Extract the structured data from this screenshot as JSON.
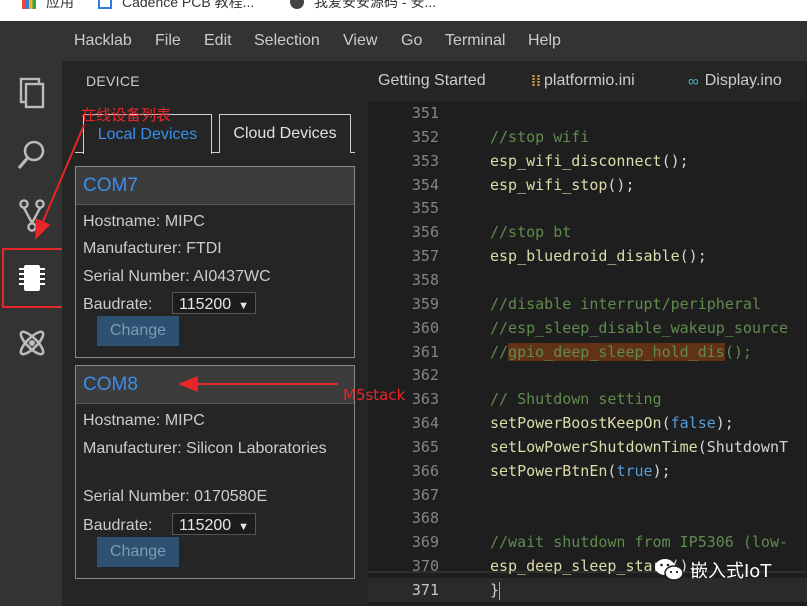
{
  "browser_bookmarks": [
    {
      "label": "应用"
    },
    {
      "label": "Cadence PCB 教程..."
    },
    {
      "label": "我爱安安源码 - 安..."
    }
  ],
  "menubar": {
    "items": [
      "Hacklab",
      "File",
      "Edit",
      "Selection",
      "View",
      "Go",
      "Terminal",
      "Help"
    ]
  },
  "activitybar": {
    "icons": [
      "explorer-icon",
      "search-icon",
      "source-control-icon",
      "device-chip-icon",
      "atom-icon"
    ]
  },
  "sidebar": {
    "title": "DEVICE",
    "tabs": [
      {
        "label": "Local Devices",
        "active": true
      },
      {
        "label": "Cloud Devices",
        "active": false
      }
    ],
    "devices": [
      {
        "port": "COM7",
        "hostname": "Hostname: MIPC",
        "manufacturer": "Manufacturer: FTDI",
        "serial": "Serial Number: AI0437WC",
        "baudrate_label": "Baudrate:",
        "baudrate_value": "115200",
        "change_label": "Change"
      },
      {
        "port": "COM8",
        "hostname": "Hostname: MIPC",
        "manufacturer": "Manufacturer: Silicon Laboratories",
        "serial": "Serial Number: 0170580E",
        "baudrate_label": "Baudrate:",
        "baudrate_value": "115200",
        "change_label": "Change"
      }
    ]
  },
  "editor": {
    "tabs": [
      {
        "label": "Getting Started",
        "icon": null
      },
      {
        "label": "platformio.ini",
        "icon": "ini-file-icon"
      },
      {
        "label": "Display.ino",
        "icon": "ino-file-icon"
      }
    ],
    "current_line": "371",
    "lines": [
      {
        "n": "351",
        "tokens": []
      },
      {
        "n": "352",
        "tokens": [
          {
            "t": "//stop wifi",
            "c": "comment"
          }
        ]
      },
      {
        "n": "353",
        "tokens": [
          {
            "t": "esp_wifi_disconnect",
            "c": "fn"
          },
          {
            "t": "();",
            "c": "plain"
          }
        ]
      },
      {
        "n": "354",
        "tokens": [
          {
            "t": "esp_wifi_stop",
            "c": "fn"
          },
          {
            "t": "();",
            "c": "plain"
          }
        ]
      },
      {
        "n": "355",
        "tokens": []
      },
      {
        "n": "356",
        "tokens": [
          {
            "t": "//stop bt",
            "c": "comment"
          }
        ]
      },
      {
        "n": "357",
        "tokens": [
          {
            "t": "esp_bluedroid_disable",
            "c": "fn"
          },
          {
            "t": "();",
            "c": "plain"
          }
        ]
      },
      {
        "n": "358",
        "tokens": []
      },
      {
        "n": "359",
        "tokens": [
          {
            "t": "//disable interrupt/peripheral",
            "c": "comment"
          }
        ]
      },
      {
        "n": "360",
        "tokens": [
          {
            "t": "//esp_sleep_disable_wakeup_source",
            "c": "comment"
          }
        ]
      },
      {
        "n": "361",
        "tokens": [
          {
            "t": "//",
            "c": "comment"
          },
          {
            "t": "gpio_deep_sleep_hold_dis",
            "c": "hl"
          },
          {
            "t": "();",
            "c": "comment"
          }
        ]
      },
      {
        "n": "362",
        "tokens": []
      },
      {
        "n": "363",
        "tokens": [
          {
            "t": "// Shutdown setting",
            "c": "comment"
          }
        ]
      },
      {
        "n": "364",
        "tokens": [
          {
            "t": "setPowerBoostKeepOn",
            "c": "fn"
          },
          {
            "t": "(",
            "c": "plain"
          },
          {
            "t": "false",
            "c": "kw"
          },
          {
            "t": ");",
            "c": "plain"
          }
        ]
      },
      {
        "n": "365",
        "tokens": [
          {
            "t": "setLowPowerShutdownTime",
            "c": "fn"
          },
          {
            "t": "(ShutdownT",
            "c": "plain"
          }
        ]
      },
      {
        "n": "366",
        "tokens": [
          {
            "t": "setPowerBtnEn",
            "c": "fn"
          },
          {
            "t": "(",
            "c": "plain"
          },
          {
            "t": "true",
            "c": "kw"
          },
          {
            "t": ");",
            "c": "plain"
          }
        ]
      },
      {
        "n": "367",
        "tokens": []
      },
      {
        "n": "368",
        "tokens": []
      },
      {
        "n": "369",
        "tokens": [
          {
            "t": "//wait shutdown from IP5306 (low-",
            "c": "comment"
          }
        ]
      },
      {
        "n": "370",
        "tokens": [
          {
            "t": "esp_deep_sleep_start",
            "c": "fn"
          },
          {
            "t": "();",
            "c": "plain"
          }
        ]
      },
      {
        "n": "371",
        "tokens": [
          {
            "t": "}",
            "c": "plain"
          }
        ]
      }
    ]
  },
  "annotations": {
    "device_list": "在线设备列表",
    "m5stack": "M5stack",
    "color": "#e8262a"
  },
  "watermark": {
    "text": "嵌入式IoT"
  },
  "colors": {
    "accent": "#3b8eea",
    "background": "#1e1e1e",
    "sidebar": "#252526",
    "bar": "#333333"
  }
}
